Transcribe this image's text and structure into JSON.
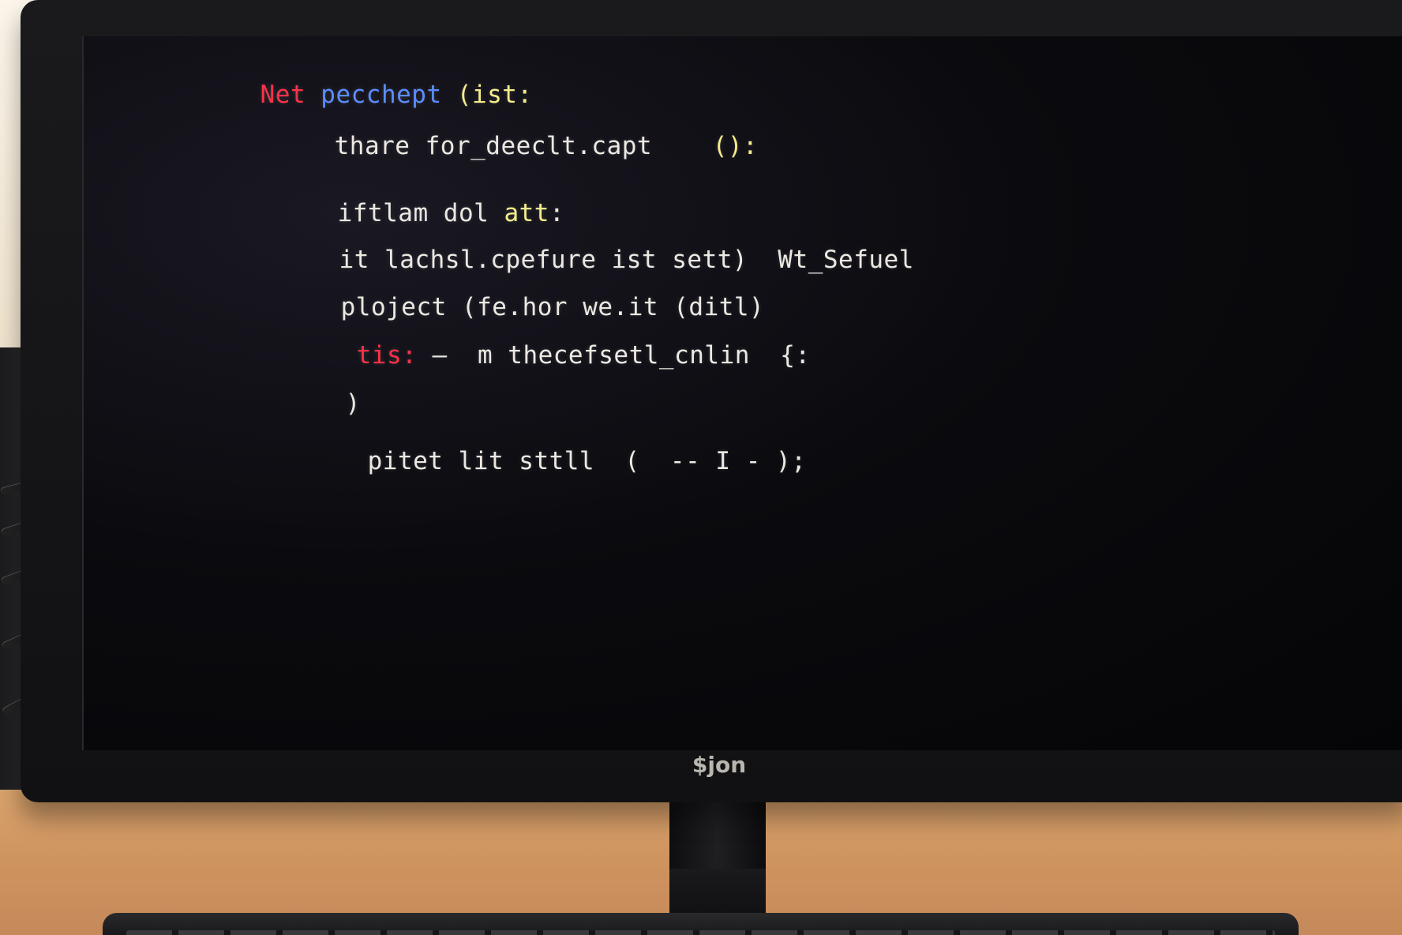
{
  "scene": {
    "description_kind": "photo of a desktop monitor showing source code",
    "monitor_brand": "$jon"
  },
  "code_lines": [
    {
      "tokens": [
        {
          "text": "Net ",
          "color": "red"
        },
        {
          "text": "pecchept ",
          "color": "blue"
        },
        {
          "text": "(ist:",
          "color": "yellow"
        }
      ]
    },
    {
      "tokens": [
        {
          "text": "thare for_deeclt.capt    ",
          "color": "white"
        },
        {
          "text": "():",
          "color": "yellow"
        }
      ]
    },
    {
      "tokens": [
        {
          "text": "iftlam dol ",
          "color": "white"
        },
        {
          "text": "att",
          "color": "yellow"
        },
        {
          "text": ":",
          "color": "white"
        }
      ]
    },
    {
      "tokens": [
        {
          "text": "it lachsl.cpefure ist sett)  Wt_Sefuel",
          "color": "white"
        }
      ]
    },
    {
      "tokens": [
        {
          "text": "ploject (fe.hor we.it (ditl)",
          "color": "white"
        }
      ]
    },
    {
      "tokens": [
        {
          "text": "tis:",
          "color": "red"
        },
        {
          "text": " –  m thecefsetl_cnlin  {:",
          "color": "white"
        }
      ]
    },
    {
      "tokens": [
        {
          "text": ")",
          "color": "white"
        }
      ]
    },
    {
      "tokens": [
        {
          "text": "pitet lit sttll  (  -- I - );",
          "color": "white"
        }
      ]
    }
  ],
  "colors": {
    "screen_background": "#07070a",
    "red": "#ff3148",
    "blue": "#5b8cff",
    "yellow": "#f4ec8c",
    "white": "#ece8e2"
  }
}
